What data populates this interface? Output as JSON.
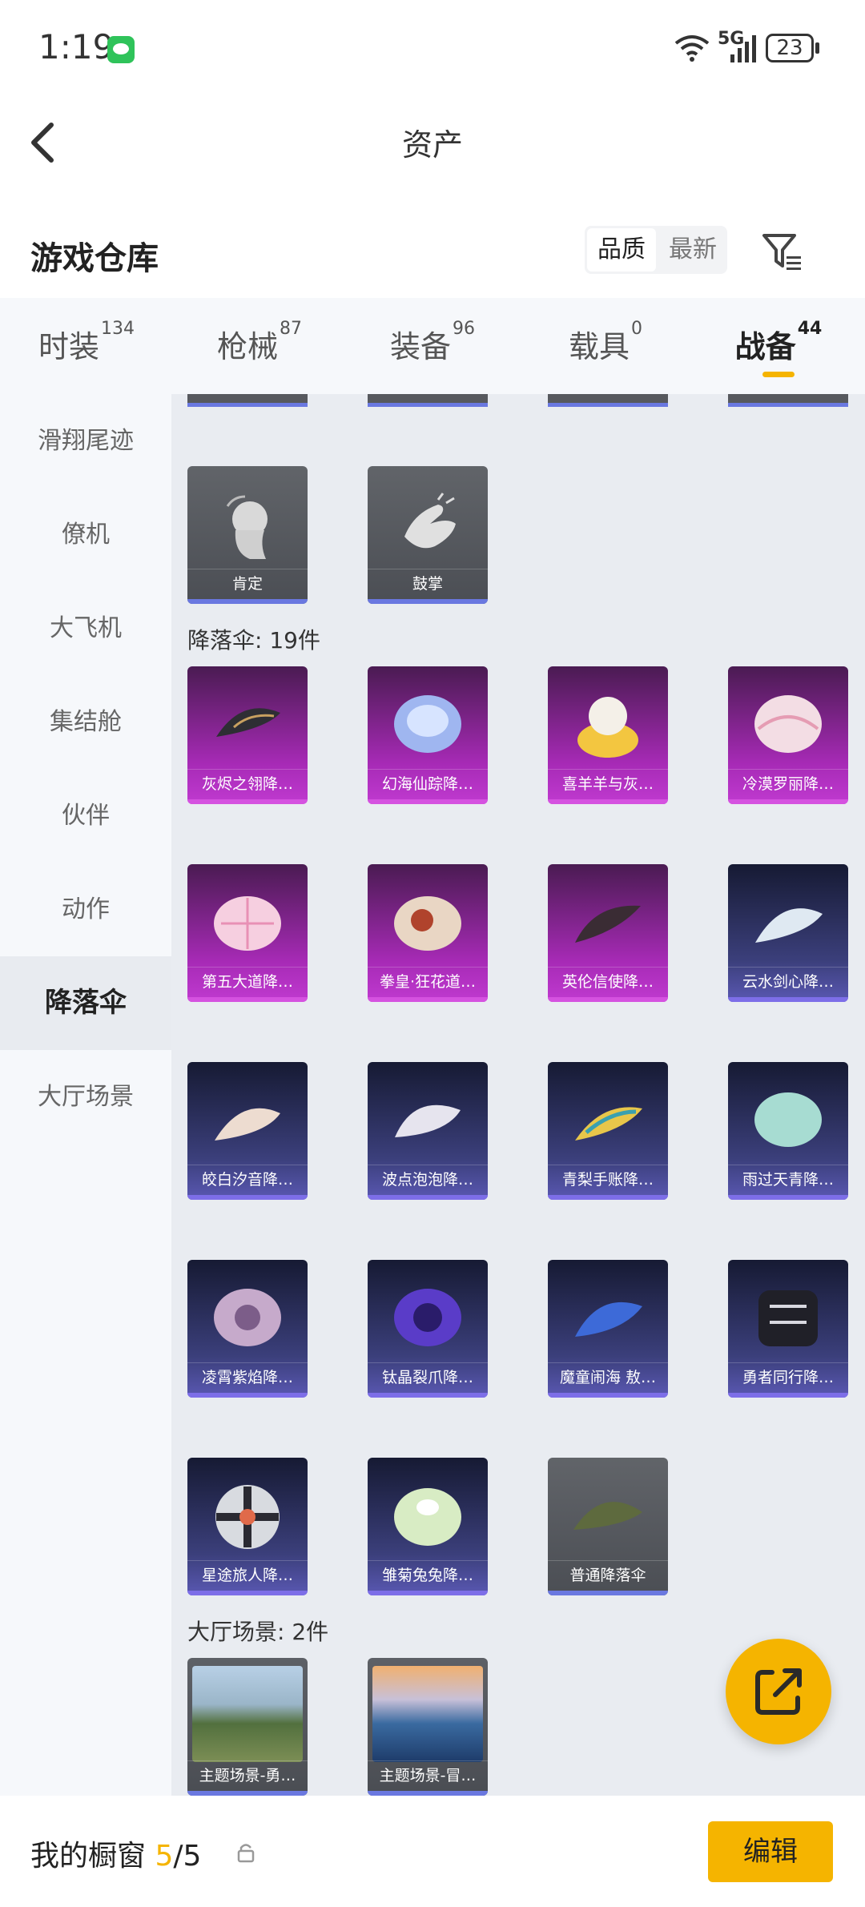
{
  "status_bar": {
    "time": "1:19",
    "network": "5G",
    "battery": "23"
  },
  "header": {
    "title": "资产"
  },
  "warehouse": {
    "title": "游戏仓库",
    "sort_options": [
      "品质",
      "最新"
    ],
    "active_sort": "品质"
  },
  "tabs": [
    {
      "label": "时装",
      "count": "134"
    },
    {
      "label": "枪械",
      "count": "87"
    },
    {
      "label": "装备",
      "count": "96"
    },
    {
      "label": "载具",
      "count": "0"
    },
    {
      "label": "战备",
      "count": "44",
      "active": true
    }
  ],
  "sidebar": {
    "items": [
      "滑翔尾迹",
      "僚机",
      "大飞机",
      "集结舱",
      "伙伴",
      "动作",
      "降落伞",
      "大厅场景"
    ],
    "active": "降落伞"
  },
  "sections": {
    "actions": {
      "items": [
        "肯定",
        "鼓掌"
      ]
    },
    "parachutes": {
      "title": "降落伞: 19件",
      "items": [
        "灰烬之翎降…",
        "幻海仙踪降…",
        "喜羊羊与灰…",
        "冷漠罗丽降…",
        "第五大道降…",
        "拳皇·狂花道…",
        "英伦信使降…",
        "云水剑心降…",
        "皎白汐音降…",
        "波点泡泡降…",
        "青梨手账降…",
        "雨过天青降…",
        "凌霄紫焰降…",
        "钛晶裂爪降…",
        "魔童闹海 敖…",
        "勇者同行降…",
        "星途旅人降…",
        "雏菊兔兔降…",
        "普通降落伞"
      ]
    },
    "lobby": {
      "title": "大厅场景: 2件",
      "items": [
        "主题场景-勇…",
        "主题场景-冒…"
      ]
    }
  },
  "bottom_bar": {
    "label": "我的橱窗",
    "count": "5",
    "total": "/5",
    "edit_label": "编辑"
  },
  "colors": {
    "accent": "#f5b400",
    "purple_rarity": "#c03ad0",
    "blue_rarity": "#5a58b3",
    "gray_rarity": "#4b4e54"
  }
}
